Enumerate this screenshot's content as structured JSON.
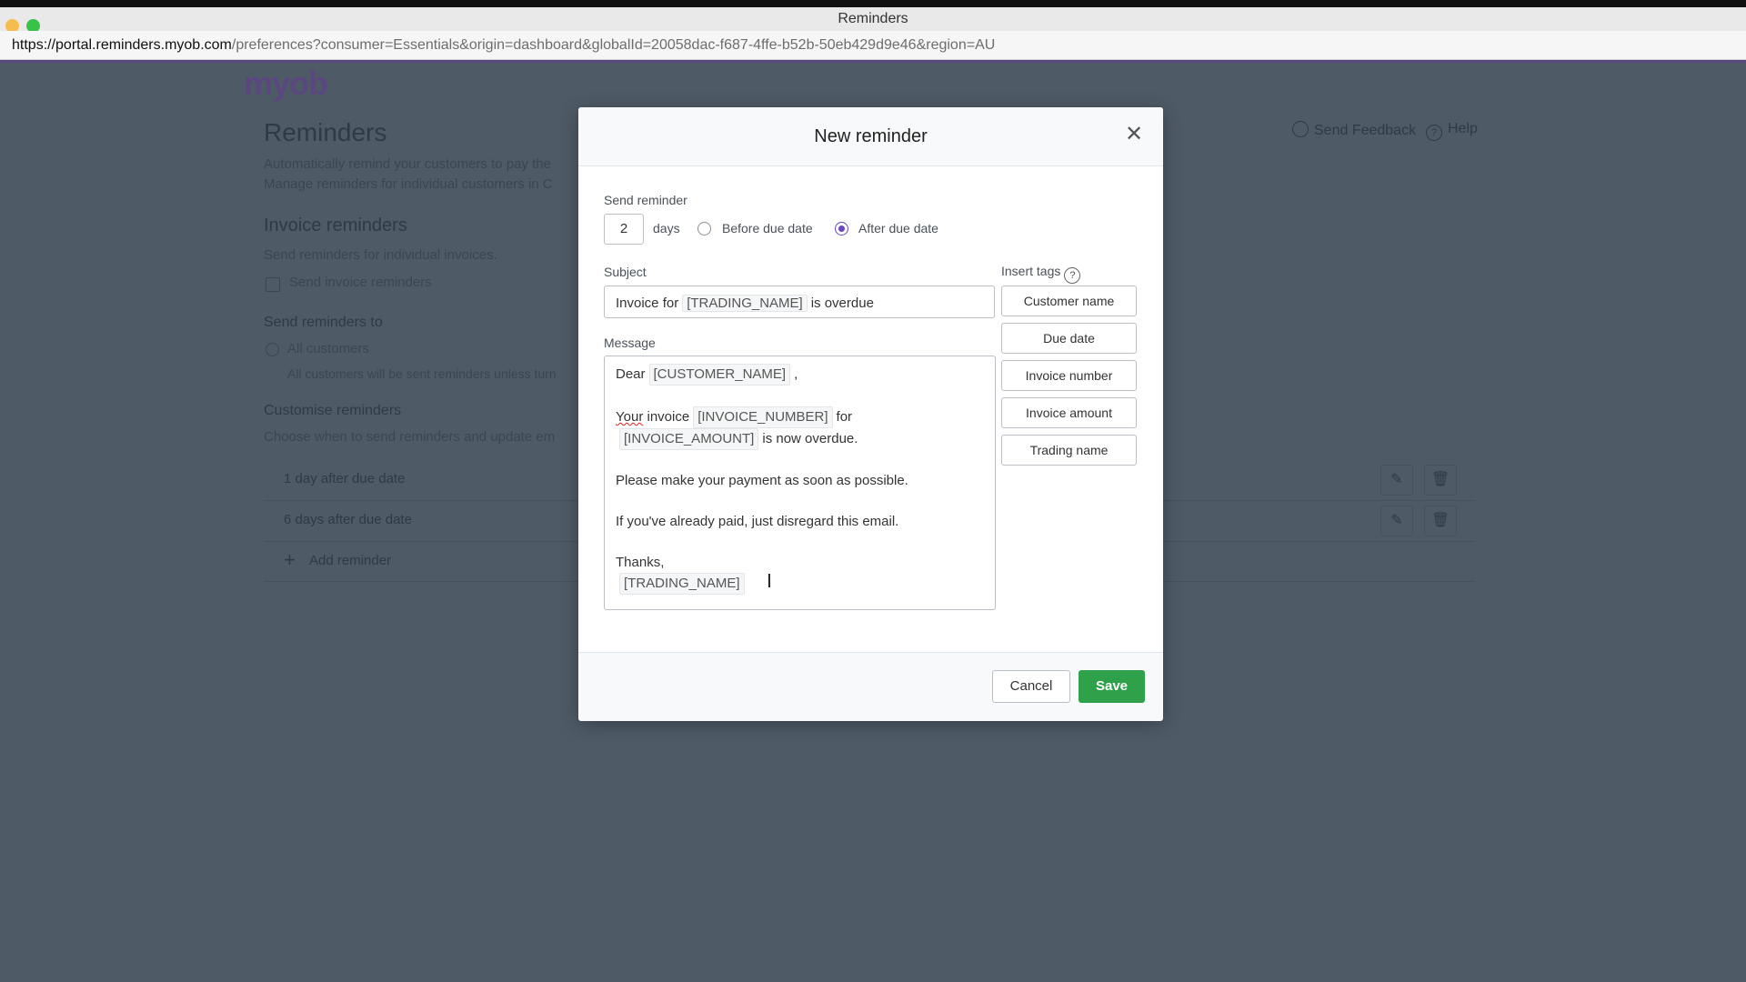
{
  "window": {
    "title": "Reminders",
    "url_host": "https://portal.reminders.myob.com",
    "url_path": "/preferences?consumer=Essentials&origin=dashboard&globalId=20058dac-f687-4ffe-b52b-50eb429d9e46&region=AU"
  },
  "background": {
    "logo": "myob",
    "title": "Reminders",
    "desc1": "Automatically remind your customers to pay the",
    "desc2": "Manage reminders for individual customers in C",
    "invoice_heading": "Invoice reminders",
    "invoice_desc": "Send reminders for individual invoices.",
    "send_invoice_label": "Send invoice reminders",
    "send_to_heading": "Send reminders to",
    "all_customers": "All customers",
    "all_customers_desc": "All customers will be sent reminders unless turn",
    "customise_heading": "Customise reminders",
    "customise_desc": "Choose when to send reminders and update em",
    "rows": [
      "1 day after due date",
      "6 days after due date"
    ],
    "add_reminder": "Add reminder",
    "send_feedback": "Send Feedback",
    "help": "Help"
  },
  "modal": {
    "title": "New reminder",
    "send_reminder_label": "Send reminder",
    "days_value": "2",
    "days_label": "days",
    "before_label": "Before due date",
    "after_label": "After due date",
    "selected": "after",
    "subject_label": "Subject",
    "subject": {
      "pre": "Invoice for",
      "tag": "[TRADING_NAME]",
      "post": "is overdue"
    },
    "message_label": "Message",
    "message": {
      "dear": "Dear",
      "customer_tag": "[CUSTOMER_NAME]",
      "comma": ",",
      "your": "Your",
      "invoice_word": "invoice",
      "invoice_number_tag": "[INVOICE_NUMBER]",
      "for_word": "for",
      "invoice_amount_tag": "[INVOICE_AMOUNT]",
      "now_overdue": "is now overdue.",
      "line_payment": "Please make your payment as soon as possible.",
      "line_paid": "If you've already paid, just disregard this email.",
      "thanks": "Thanks,",
      "trading_tag": "[TRADING_NAME]"
    },
    "insert_tags_label": "Insert tags",
    "tags": [
      "Customer name",
      "Due date",
      "Invoice number",
      "Invoice amount",
      "Trading name"
    ],
    "cancel_label": "Cancel",
    "save_label": "Save"
  },
  "colors": {
    "accent": "#6b46c1",
    "save": "#2ea14a",
    "overlay": "#4e5a66"
  }
}
